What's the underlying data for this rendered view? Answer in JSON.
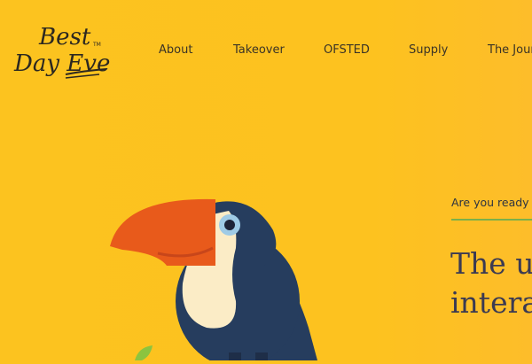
{
  "logo": {
    "line1": "Best",
    "line2": "Day Eve",
    "tm": "TM"
  },
  "nav": {
    "items": [
      {
        "id": "about",
        "label": "About"
      },
      {
        "id": "takeover",
        "label": "Takeover"
      },
      {
        "id": "ofsted",
        "label": "OFSTED"
      },
      {
        "id": "supply",
        "label": "Supply"
      },
      {
        "id": "journey",
        "label": "The Journ"
      }
    ]
  },
  "hero": {
    "eyebrow": "Are you ready",
    "headline_line1": "The ur",
    "headline_line2": "interac"
  },
  "colors": {
    "background": "#fcc31f",
    "accent_line": "#7bb04a",
    "toucan_body": "#263d5e",
    "toucan_beak": "#e85a1b",
    "toucan_chest": "#fbecc6"
  }
}
